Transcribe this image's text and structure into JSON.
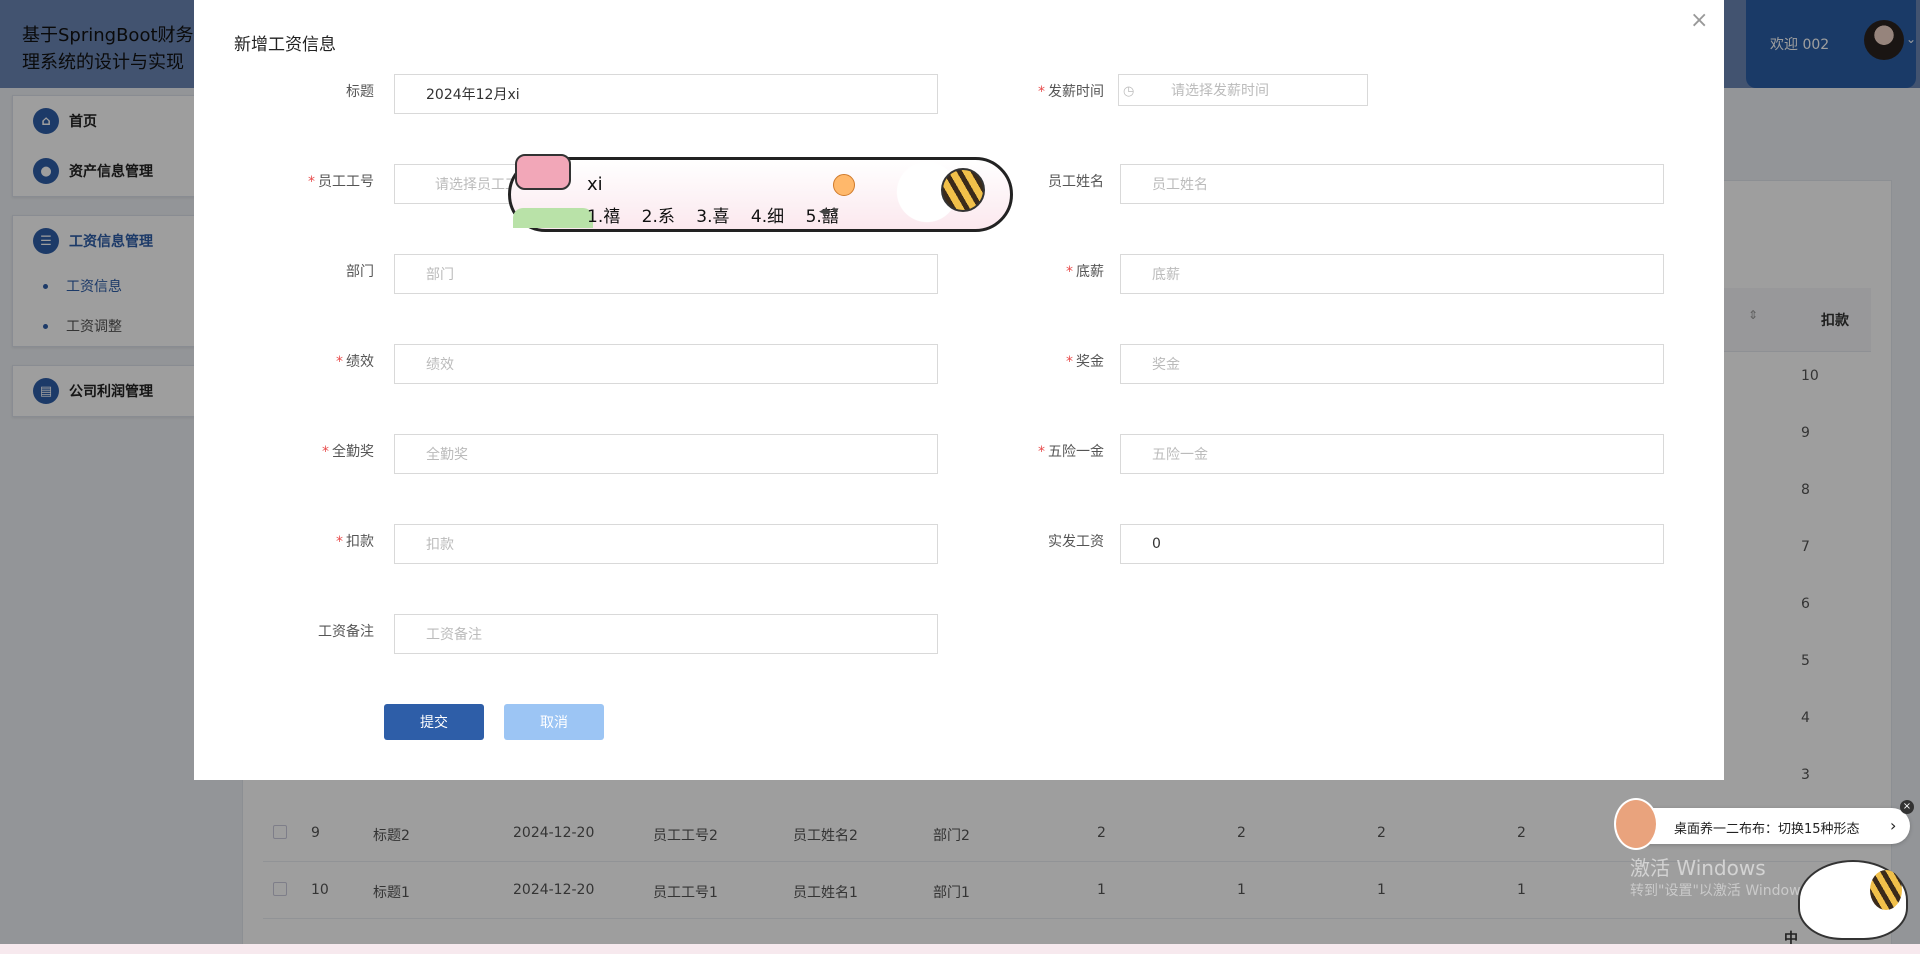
{
  "app": {
    "title": "基于SpringBoot财务管理系统的设计与实现",
    "welcome": "欢迎 002"
  },
  "sidebar": {
    "home": "首页",
    "assets": "资产信息管理",
    "salary": "工资信息管理",
    "salary_sub": [
      "工资信息",
      "工资调整"
    ],
    "profit": "公司利润管理"
  },
  "table": {
    "header_deduct": "扣款",
    "deduct_values": [
      "10",
      "9",
      "8",
      "7",
      "6",
      "5",
      "4",
      "3"
    ],
    "rows": [
      {
        "id": "9",
        "title": "标题2",
        "date": "2024-12-20",
        "emp_no": "员工工号2",
        "emp_name": "员工姓名2",
        "dept": "部门2",
        "v1": "2",
        "v2": "2",
        "v3": "2",
        "v4": "2"
      },
      {
        "id": "10",
        "title": "标题1",
        "date": "2024-12-20",
        "emp_no": "员工工号1",
        "emp_name": "员工姓名1",
        "dept": "部门1",
        "v1": "1",
        "v2": "1",
        "v3": "1",
        "v4": "1"
      }
    ]
  },
  "modal": {
    "title": "新增工资信息",
    "close": "×",
    "fields": {
      "title": {
        "label": "标题",
        "value": "2024年12月xi"
      },
      "pay_time": {
        "label": "发薪时间",
        "placeholder": "请选择发薪时间"
      },
      "emp_no": {
        "label": "员工工号",
        "placeholder": "请选择员工工号"
      },
      "emp_name": {
        "label": "员工姓名",
        "placeholder": "员工姓名"
      },
      "dept": {
        "label": "部门",
        "placeholder": "部门"
      },
      "base": {
        "label": "底薪",
        "placeholder": "底薪"
      },
      "perf": {
        "label": "绩效",
        "placeholder": "绩效"
      },
      "bonus": {
        "label": "奖金",
        "placeholder": "奖金"
      },
      "attend": {
        "label": "全勤奖",
        "placeholder": "全勤奖"
      },
      "insurance": {
        "label": "五险一金",
        "placeholder": "五险一金"
      },
      "deduct": {
        "label": "扣款",
        "placeholder": "扣款"
      },
      "actual": {
        "label": "实发工资",
        "value": "0"
      },
      "remark": {
        "label": "工资备注",
        "placeholder": "工资备注"
      }
    },
    "submit": "提交",
    "cancel": "取消"
  },
  "ime": {
    "pinyin": "xi",
    "candidates": [
      "1.禧",
      "2.系",
      "3.喜",
      "4.细",
      "5.囍"
    ],
    "pager": "◂▸▾"
  },
  "desktop": {
    "toast": "桌面养一二布布：切换15种形态",
    "toast_arrow": "›",
    "toast_close": "×",
    "watermark_title": "激活 Windows",
    "watermark_sub": "转到\"设置\"以激活 Windows。",
    "taskbar_ime": "中"
  }
}
